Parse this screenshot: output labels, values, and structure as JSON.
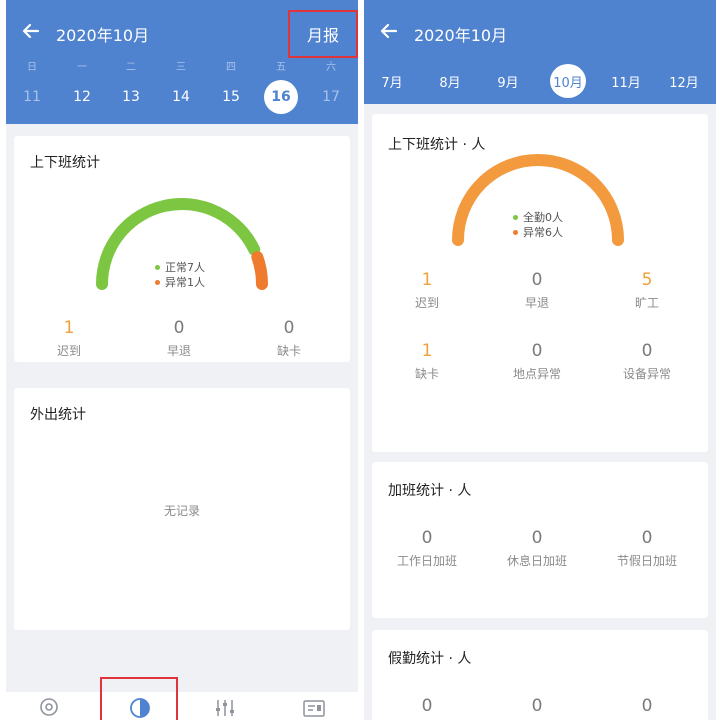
{
  "left": {
    "header": {
      "title": "2020年10月",
      "report_button": "月报"
    },
    "weekdays": [
      "日",
      "一",
      "二",
      "三",
      "四",
      "五",
      "六"
    ],
    "dates": [
      {
        "label": "11",
        "state": "dim"
      },
      {
        "label": "12",
        "state": "normal"
      },
      {
        "label": "13",
        "state": "normal"
      },
      {
        "label": "14",
        "state": "normal"
      },
      {
        "label": "15",
        "state": "normal"
      },
      {
        "label": "16",
        "state": "selected"
      },
      {
        "label": "17",
        "state": "dim"
      }
    ],
    "attendance_card": {
      "title": "上下班统计",
      "legend": [
        {
          "text": "正常7人",
          "color": "#7cc641"
        },
        {
          "text": "异常1人",
          "color": "#ef7b2f"
        }
      ],
      "gauge": {
        "normal": 7,
        "abnormal": 1,
        "normal_color": "#7cc641",
        "abnormal_color": "#ef7b2f"
      },
      "stats": [
        {
          "value": "1",
          "label": "迟到",
          "highlight": true
        },
        {
          "value": "0",
          "label": "早退",
          "highlight": false
        },
        {
          "value": "0",
          "label": "缺卡",
          "highlight": false
        }
      ]
    },
    "outing_card": {
      "title": "外出统计",
      "empty_text": "无记录"
    },
    "nav_icons": [
      "location-icon",
      "statistics-icon",
      "settings-sliders-icon",
      "report-card-icon"
    ]
  },
  "right": {
    "header": {
      "title": "2020年10月"
    },
    "months": [
      {
        "label": "7月",
        "selected": false
      },
      {
        "label": "8月",
        "selected": false
      },
      {
        "label": "9月",
        "selected": false
      },
      {
        "label": "10月",
        "selected": true
      },
      {
        "label": "11月",
        "selected": false
      },
      {
        "label": "12月",
        "selected": false
      }
    ],
    "attendance_card": {
      "title": "上下班统计 · 人",
      "legend": [
        {
          "text": "全勤0人",
          "color": "#7cc641"
        },
        {
          "text": "异常6人",
          "color": "#ef7b2f"
        }
      ],
      "gauge": {
        "normal": 0,
        "abnormal": 6,
        "normal_color": "#7cc641",
        "abnormal_color": "#f29a3d"
      },
      "stats_row1": [
        {
          "value": "1",
          "label": "迟到",
          "highlight": true
        },
        {
          "value": "0",
          "label": "早退",
          "highlight": false
        },
        {
          "value": "5",
          "label": "旷工",
          "highlight": true
        }
      ],
      "stats_row2": [
        {
          "value": "1",
          "label": "缺卡",
          "highlight": true
        },
        {
          "value": "0",
          "label": "地点异常",
          "highlight": false
        },
        {
          "value": "0",
          "label": "设备异常",
          "highlight": false
        }
      ]
    },
    "overtime_card": {
      "title": "加班统计 · 人",
      "stats": [
        {
          "value": "0",
          "label": "工作日加班",
          "highlight": false
        },
        {
          "value": "0",
          "label": "休息日加班",
          "highlight": false
        },
        {
          "value": "0",
          "label": "节假日加班",
          "highlight": false
        }
      ]
    },
    "leave_card": {
      "title": "假勤统计 · 人",
      "stats": [
        {
          "value": "0",
          "highlight": false
        },
        {
          "value": "0",
          "highlight": false
        },
        {
          "value": "0",
          "highlight": false
        }
      ]
    }
  }
}
